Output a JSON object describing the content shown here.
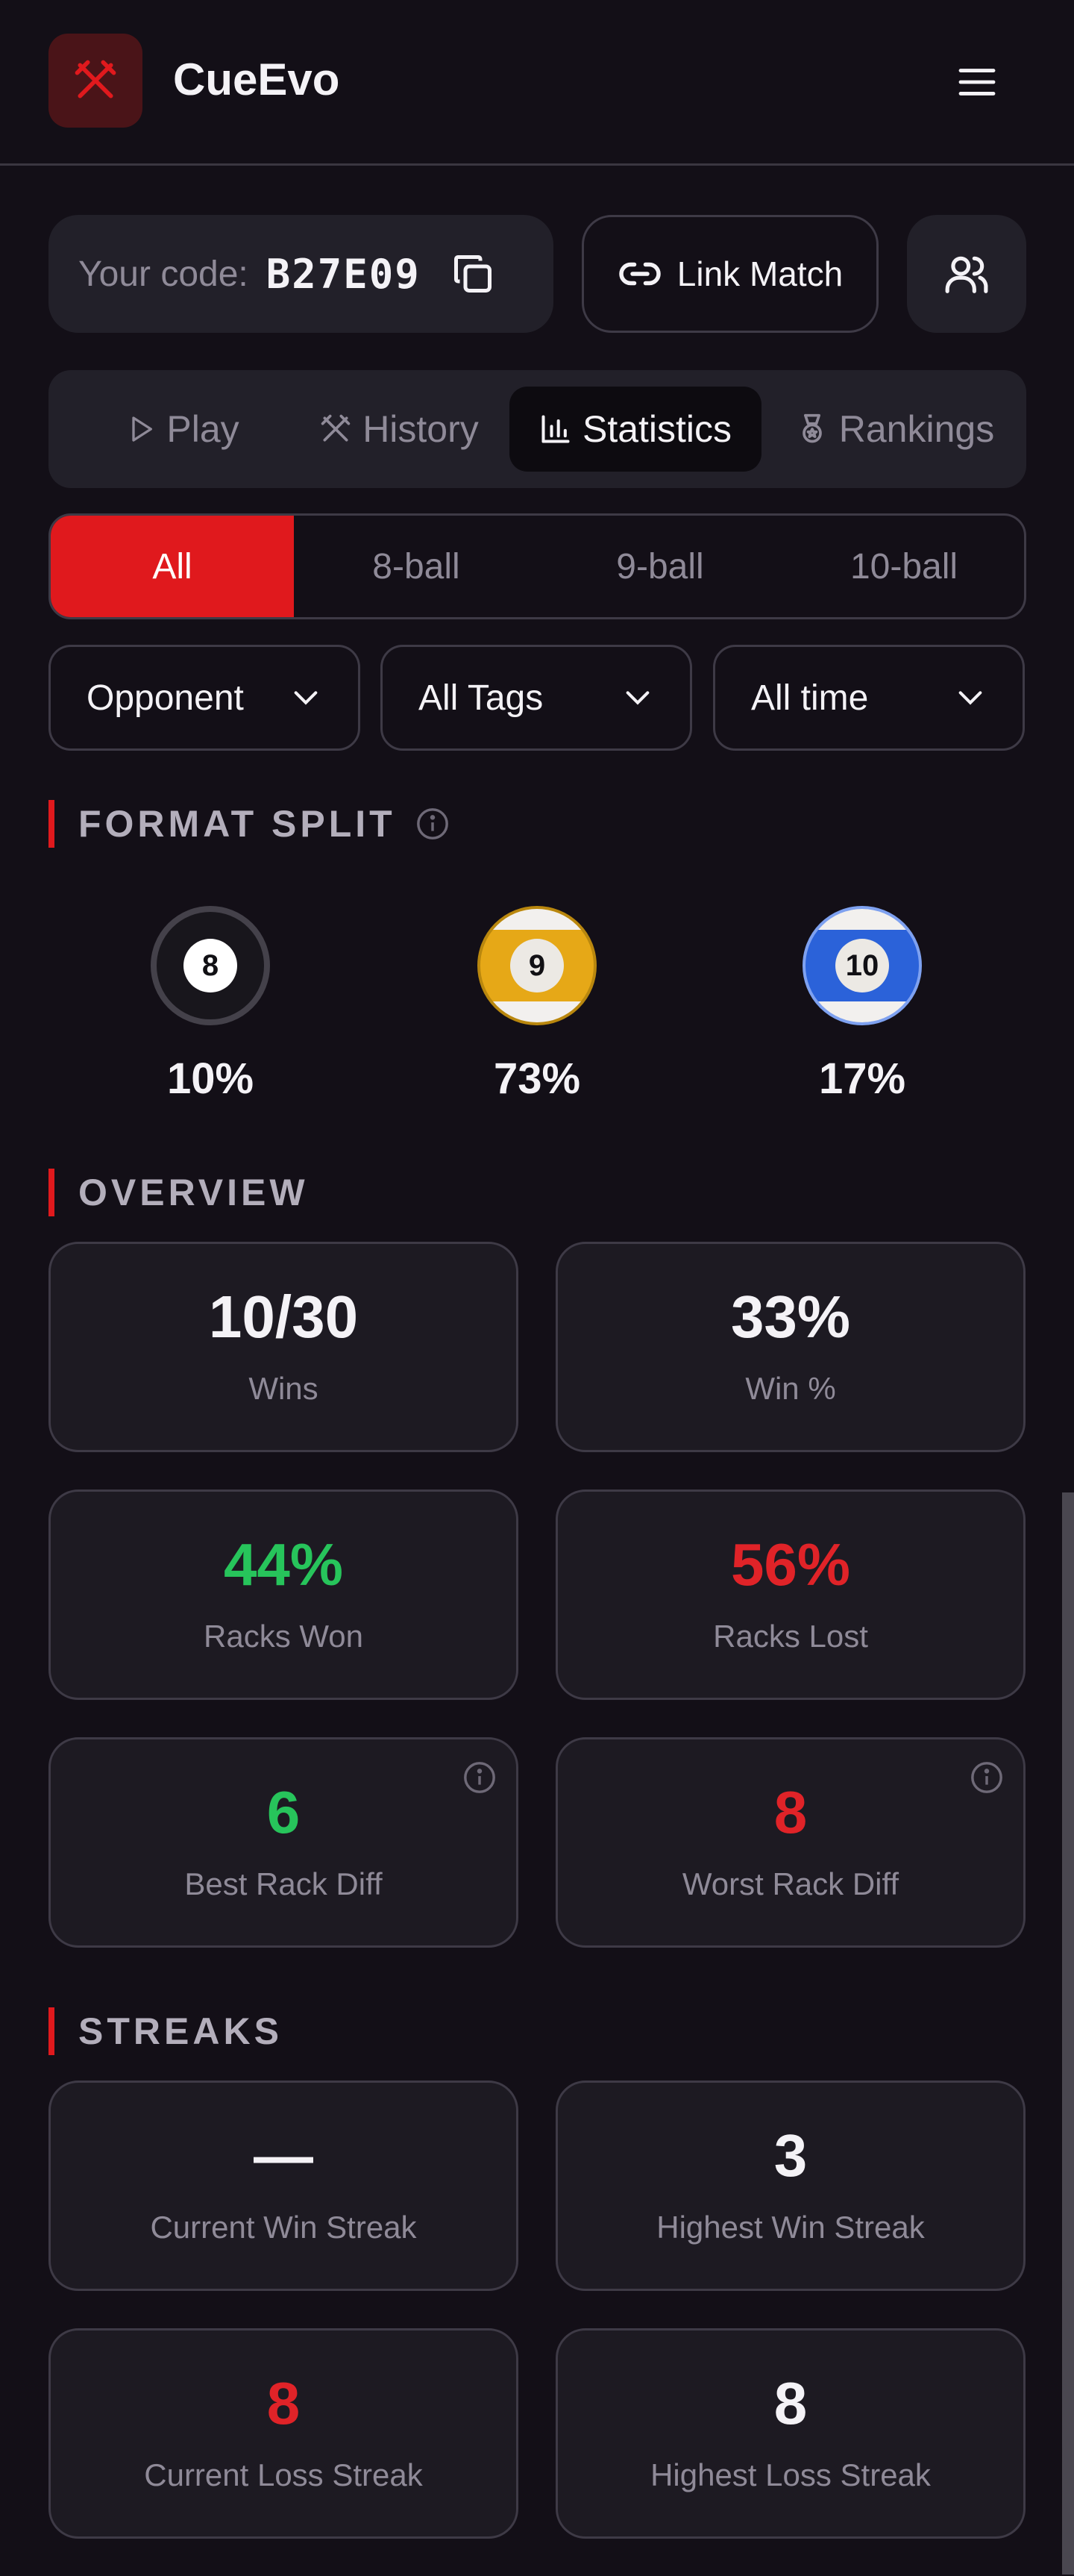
{
  "header": {
    "title": "CueEvo",
    "logo_icon": "crossed-cues-icon",
    "menu_icon": "hamburger-icon"
  },
  "code": {
    "label": "Your code:",
    "value": "B27E09",
    "copy_icon": "copy-icon"
  },
  "link_match": {
    "label": "Link Match",
    "icon": "link-icon"
  },
  "friends": {
    "icon": "users-icon"
  },
  "tabs": [
    {
      "label": "Play",
      "icon": "play-icon"
    },
    {
      "label": "History",
      "icon": "crossed-cues-icon"
    },
    {
      "label": "Statistics",
      "icon": "bar-chart-icon",
      "active": true
    },
    {
      "label": "Rankings",
      "icon": "medal-icon"
    }
  ],
  "format_filter": [
    "All",
    "8-ball",
    "9-ball",
    "10-ball"
  ],
  "format_filter_selected": "All",
  "filters": {
    "opponent": "Opponent",
    "tags": "All Tags",
    "time": "All time"
  },
  "format_split": {
    "title": "FORMAT SPLIT",
    "items": [
      {
        "ball": "8",
        "percent": "10%"
      },
      {
        "ball": "9",
        "percent": "73%"
      },
      {
        "ball": "10",
        "percent": "17%"
      }
    ]
  },
  "overview": {
    "title": "OVERVIEW",
    "wins": {
      "value": "10/30",
      "label": "Wins"
    },
    "win_pct": {
      "value": "33%",
      "label": "Win %"
    },
    "racks_won": {
      "value": "44%",
      "label": "Racks Won"
    },
    "racks_lost": {
      "value": "56%",
      "label": "Racks Lost"
    },
    "best_rack_diff": {
      "value": "6",
      "label": "Best Rack Diff"
    },
    "worst_rack_diff": {
      "value": "8",
      "label": "Worst Rack Diff"
    }
  },
  "streaks": {
    "title": "STREAKS",
    "current_win": {
      "value": "—",
      "label": "Current Win Streak"
    },
    "highest_win": {
      "value": "3",
      "label": "Highest Win Streak"
    },
    "current_loss": {
      "value": "8",
      "label": "Current Loss Streak"
    },
    "highest_loss": {
      "value": "8",
      "label": "Highest Loss Streak"
    }
  },
  "colors": {
    "accent": "#e0191d",
    "positive": "#27c45b",
    "negative": "#e02328",
    "background": "#130f17",
    "card": "#1d1a22"
  }
}
